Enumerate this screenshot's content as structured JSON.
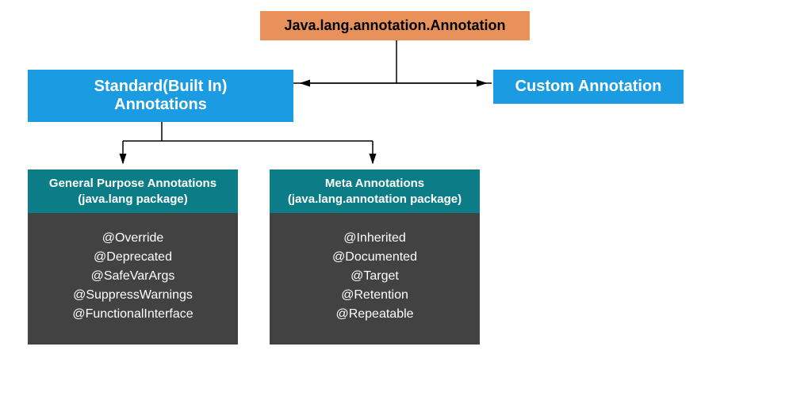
{
  "root": {
    "label": "Java.lang.annotation.Annotation"
  },
  "level2": {
    "standard": "Standard(Built In) Annotations",
    "custom": "Custom Annotation"
  },
  "general": {
    "title_line1": "General Purpose Annotations",
    "title_line2": "(java.lang package)",
    "items": [
      "@Override",
      "@Deprecated",
      "@SafeVarArgs",
      "@SuppressWarnings",
      "@FunctionalInterface"
    ]
  },
  "meta": {
    "title_line1": "Meta Annotations",
    "title_line2": "(java.lang.annotation package)",
    "items": [
      "@Inherited",
      "@Documented",
      "@Target",
      "@Retention",
      "@Repeatable"
    ]
  },
  "colors": {
    "root_bg": "#e8915b",
    "blue": "#1b9ce2",
    "teal": "#0c7d86",
    "gray": "#424242"
  }
}
